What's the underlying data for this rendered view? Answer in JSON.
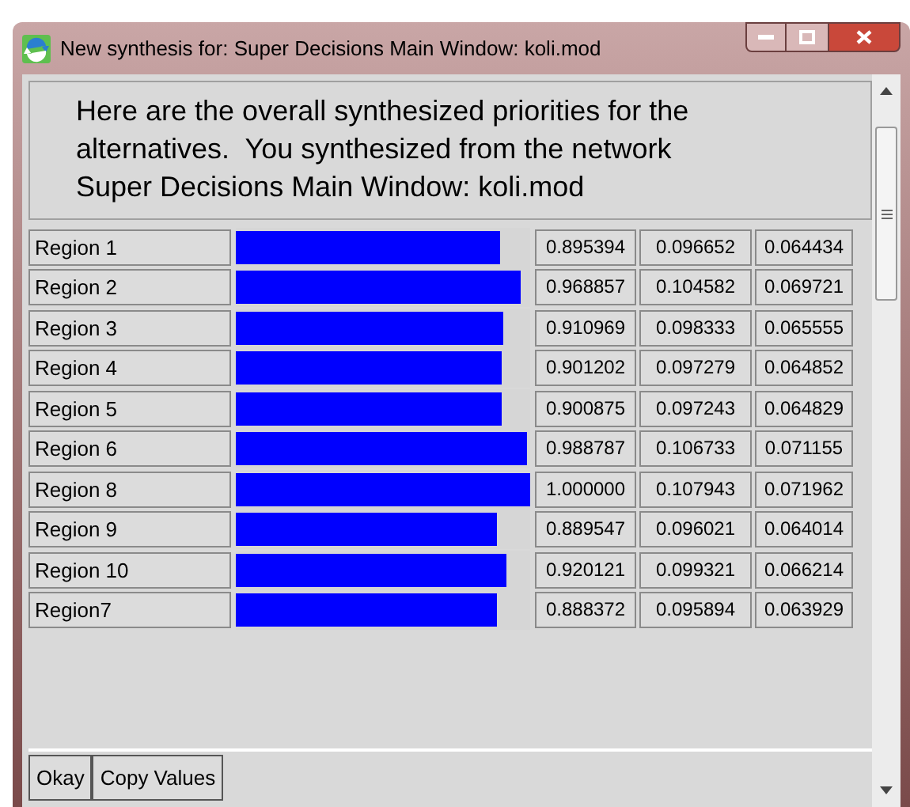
{
  "window": {
    "title": "New synthesis for: Super Decisions Main Window: koli.mod"
  },
  "message": "Here are the overall synthesized priorities for the alternatives.  You synthesized from the network Super Decisions Main Window: koli.mod",
  "rows": [
    {
      "name": "Region 1",
      "level": 0.895394,
      "values": [
        "0.895394",
        "0.096652",
        "0.064434"
      ]
    },
    {
      "name": "Region 2",
      "level": 0.968857,
      "values": [
        "0.968857",
        "0.104582",
        "0.069721"
      ]
    },
    {
      "name": "Region 3",
      "level": 0.910969,
      "values": [
        "0.910969",
        "0.098333",
        "0.065555"
      ]
    },
    {
      "name": "Region 4",
      "level": 0.901202,
      "values": [
        "0.901202",
        "0.097279",
        "0.064852"
      ]
    },
    {
      "name": "Region 5",
      "level": 0.900875,
      "values": [
        "0.900875",
        "0.097243",
        "0.064829"
      ]
    },
    {
      "name": "Region 6",
      "level": 0.988787,
      "values": [
        "0.988787",
        "0.106733",
        "0.071155"
      ]
    },
    {
      "name": "Region 8",
      "level": 1.0,
      "values": [
        "1.000000",
        "0.107943",
        "0.071962"
      ]
    },
    {
      "name": "Region 9",
      "level": 0.889547,
      "values": [
        "0.889547",
        "0.096021",
        "0.064014"
      ]
    },
    {
      "name": "Region 10",
      "level": 0.920121,
      "values": [
        "0.920121",
        "0.099321",
        "0.066214"
      ]
    },
    {
      "name": "Region7",
      "level": 0.888372,
      "values": [
        "0.888372",
        "0.095894",
        "0.063929"
      ]
    }
  ],
  "buttons": [
    "Okay",
    "Copy Values"
  ]
}
